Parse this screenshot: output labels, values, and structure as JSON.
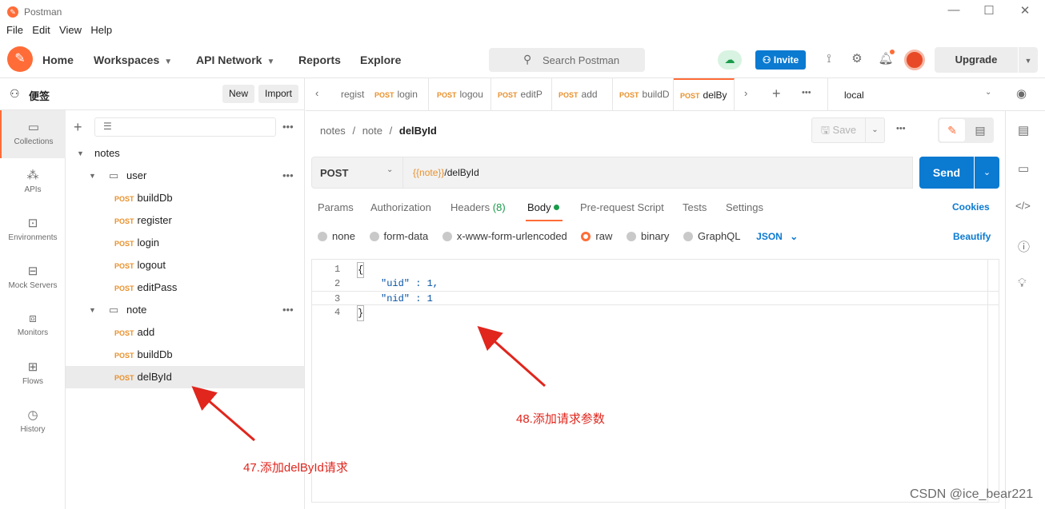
{
  "app": {
    "title": "Postman"
  },
  "menu": [
    "File",
    "Edit",
    "View",
    "Help"
  ],
  "header": {
    "home": "Home",
    "workspaces": "Workspaces",
    "api_network": "API Network",
    "reports": "Reports",
    "explore": "Explore",
    "search_placeholder": "Search Postman",
    "invite": "Invite",
    "upgrade": "Upgrade"
  },
  "workspace": {
    "name": "便签",
    "new": "New",
    "import": "Import"
  },
  "rail": [
    {
      "label": "Collections",
      "icon": "collections-icon"
    },
    {
      "label": "APIs",
      "icon": "apis-icon"
    },
    {
      "label": "Environments",
      "icon": "environments-icon"
    },
    {
      "label": "Mock Servers",
      "icon": "mock-servers-icon"
    },
    {
      "label": "Monitors",
      "icon": "monitors-icon"
    },
    {
      "label": "Flows",
      "icon": "flows-icon"
    },
    {
      "label": "History",
      "icon": "history-icon"
    }
  ],
  "tree": {
    "collection": "notes",
    "folder1": "user",
    "folder2": "note",
    "method": "POST",
    "user_items": [
      "buildDb",
      "register",
      "login",
      "logout",
      "editPass"
    ],
    "note_items": [
      "add",
      "buildDb",
      "delById"
    ]
  },
  "tabs": [
    {
      "method": "",
      "name": "regist"
    },
    {
      "method": "POST",
      "name": "login"
    },
    {
      "method": "POST",
      "name": "logou"
    },
    {
      "method": "POST",
      "name": "editP"
    },
    {
      "method": "POST",
      "name": "add"
    },
    {
      "method": "POST",
      "name": "buildD"
    },
    {
      "method": "POST",
      "name": "delBy"
    }
  ],
  "environment": "local",
  "breadcrumb": {
    "a": "notes",
    "b": "note",
    "c": "delById",
    "sep": "/"
  },
  "request": {
    "save": "Save",
    "method": "POST",
    "url_var": "{{note}}",
    "url_path": "/delById",
    "send": "Send"
  },
  "req_tabs": {
    "params": "Params",
    "auth": "Authorization",
    "headers": "Headers",
    "headers_count": "(8)",
    "body": "Body",
    "prereq": "Pre-request Script",
    "tests": "Tests",
    "settings": "Settings",
    "cookies": "Cookies"
  },
  "body_types": {
    "none": "none",
    "form": "form-data",
    "urlenc": "x-www-form-urlencoded",
    "raw": "raw",
    "binary": "binary",
    "graphql": "GraphQL",
    "json": "JSON",
    "beautify": "Beautify"
  },
  "code_lines": [
    {
      "n": "1",
      "t": "{"
    },
    {
      "n": "2",
      "t": "\"uid\" : 1,"
    },
    {
      "n": "3",
      "t": "\"nid\" : 1"
    },
    {
      "n": "4",
      "t": "}"
    }
  ],
  "annotations": {
    "a48": "48.添加请求参数",
    "a47": "47.添加delById请求"
  },
  "watermark": "CSDN @ice_bear221",
  "colors": {
    "accent": "#ff6c37",
    "send": "#0b7ad1",
    "post": "#e8912d",
    "annotation": "#e0261d",
    "link": "#0b7ad1"
  }
}
